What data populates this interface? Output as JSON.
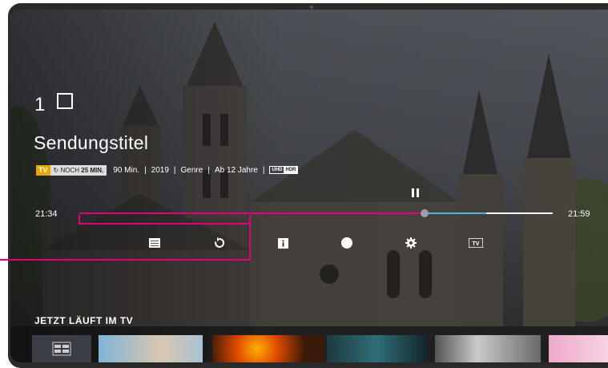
{
  "channel": {
    "number": "1"
  },
  "program": {
    "title": "Sendungstitel",
    "badge_tv": "TV",
    "badge_noch_prefix": "NOCH",
    "badge_noch_value": "25 MIN.",
    "duration": "90 Min.",
    "year": "2019",
    "genre": "Genre",
    "age_rating": "Ab 12 Jahre",
    "uhd": "UHD",
    "hdr": "HDR",
    "separator": "|"
  },
  "player": {
    "start_time": "21:34",
    "end_time": "21:59",
    "progress_fraction": 0.73,
    "buffer_end_fraction": 0.86,
    "state": "paused"
  },
  "controls": [
    {
      "name": "list-icon"
    },
    {
      "name": "replay-icon"
    },
    {
      "name": "info-icon",
      "label": "i"
    },
    {
      "name": "record-icon"
    },
    {
      "name": "settings-icon"
    },
    {
      "name": "tv-icon",
      "label": "TV"
    }
  ],
  "now_on_tv": {
    "heading": "JETZT LÄUFT IM TV"
  },
  "colors": {
    "accent": "#e2007a",
    "buffer": "#4fb2e6",
    "badge_tv": "#e8a900"
  }
}
